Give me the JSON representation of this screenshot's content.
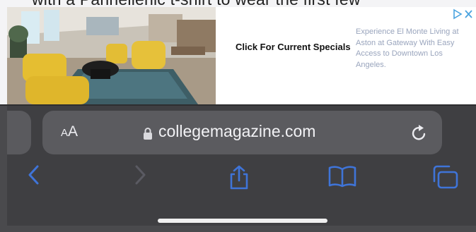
{
  "article": {
    "peek_text": "with a Panhellenic t-shirt to wear the first few"
  },
  "ad": {
    "image_alt": "Furnished lounge with yellow armchairs",
    "cta": "Click For Current Specials",
    "description": "Experience El Monte Living at Aston at Gateway With Easy Access to Downtown Los Angeles.",
    "choices_icon": "ad-choices-icon"
  },
  "address_bar": {
    "reader_small": "A",
    "reader_big": "A",
    "url": "collegemagazine.com",
    "lock_icon": "lock-icon",
    "reload_icon": "reload-icon"
  },
  "toolbar": {
    "buttons": [
      "back",
      "forward",
      "share",
      "bookmarks",
      "tabs"
    ]
  },
  "colors": {
    "toolbar_bg": "#3f3f42",
    "address_bg": "#5b5b5f",
    "accent": "#3f74d8",
    "disabled": "#5a5a62",
    "ad_text": "#9aa5bd"
  }
}
